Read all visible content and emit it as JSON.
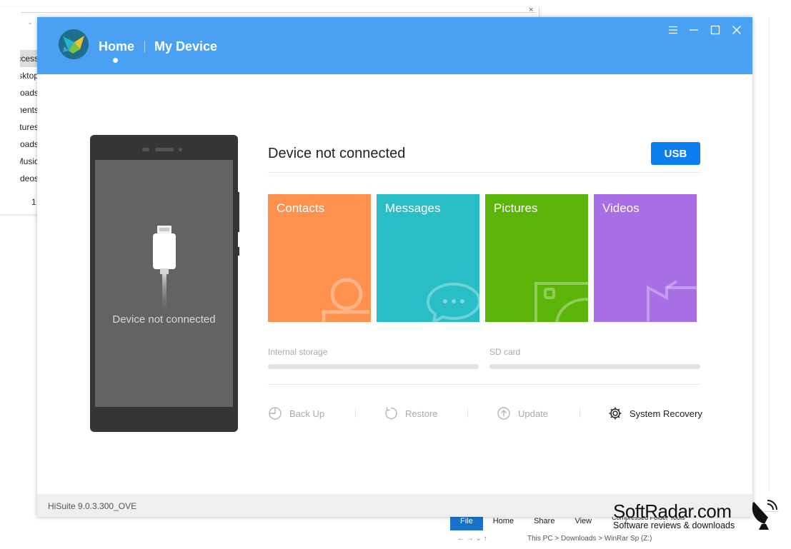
{
  "background": {
    "explorer_nav": [
      "Quick access",
      "Desktop",
      "Downloads",
      "Documents",
      "Pictures",
      "Downloads",
      "Music",
      "Videos"
    ],
    "item_count": "1",
    "ribbon_tabs": [
      "File",
      "Home",
      "Share",
      "View"
    ],
    "ribbon_context": "Compressed Folder Tools",
    "path_fragment": "This PC > Downloads > WinRar Sp (Z:)"
  },
  "header": {
    "nav_home": "Home",
    "nav_device": "My Device",
    "brand_color": "#4aa0f2"
  },
  "window_controls": {
    "menu_icon": "hamburger-icon",
    "minimize_icon": "minimize-icon",
    "maximize_icon": "maximize-icon",
    "close_icon": "close-icon"
  },
  "phone": {
    "screen_text": "Device not connected"
  },
  "main": {
    "status_title": "Device not connected",
    "usb_button": "USB",
    "tiles": [
      {
        "label": "Contacts",
        "color": "#fe914e",
        "icon": "contact-icon"
      },
      {
        "label": "Messages",
        "color": "#29bec6",
        "icon": "chat-bubble-icon"
      },
      {
        "label": "Pictures",
        "color": "#5bb508",
        "icon": "picture-icon"
      },
      {
        "label": "Videos",
        "color": "#a76ee6",
        "icon": "video-icon"
      }
    ],
    "storage": {
      "internal_label": "Internal storage",
      "sd_label": "SD card"
    },
    "actions": [
      {
        "label": "Back Up",
        "icon": "backup-clock-icon"
      },
      {
        "label": "Restore",
        "icon": "restore-icon"
      },
      {
        "label": "Update",
        "icon": "update-arrow-icon"
      },
      {
        "label": "System Recovery",
        "icon": "gear-icon"
      }
    ]
  },
  "statusbar": {
    "version": "HiSuite 9.0.3.300_OVE"
  },
  "watermark": {
    "brand": "SoftRadar.com",
    "tagline": "Software reviews & downloads"
  }
}
